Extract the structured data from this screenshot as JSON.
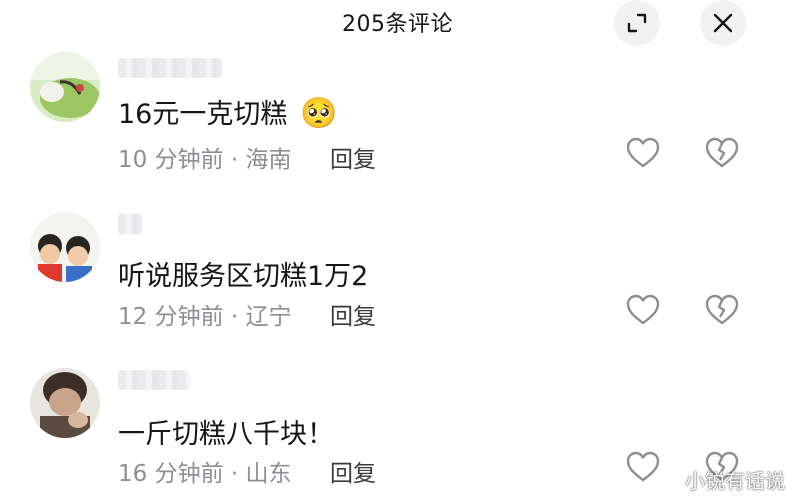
{
  "header": {
    "title": "205条评论"
  },
  "comments": [
    {
      "text": "16元一克切糕",
      "emoji": "🥺",
      "time": "10 分钟前",
      "location": "海南",
      "reply_label": "回复"
    },
    {
      "text": "听说服务区切糕1万2",
      "time": "12 分钟前",
      "location": "辽宁",
      "reply_label": "回复"
    },
    {
      "text": "一斤切糕八千块！",
      "time": "16 分钟前",
      "location": "山东",
      "reply_label": "回复"
    }
  ],
  "meta_separator": " · ",
  "watermark": "小锐有话说",
  "icons": {
    "expand": "expand-icon",
    "close": "close-icon",
    "like": "heart-icon",
    "dislike": "broken-heart-icon"
  },
  "colors": {
    "text": "#161616",
    "meta": "#8e8e93",
    "button_bg": "#f1f1f2"
  }
}
